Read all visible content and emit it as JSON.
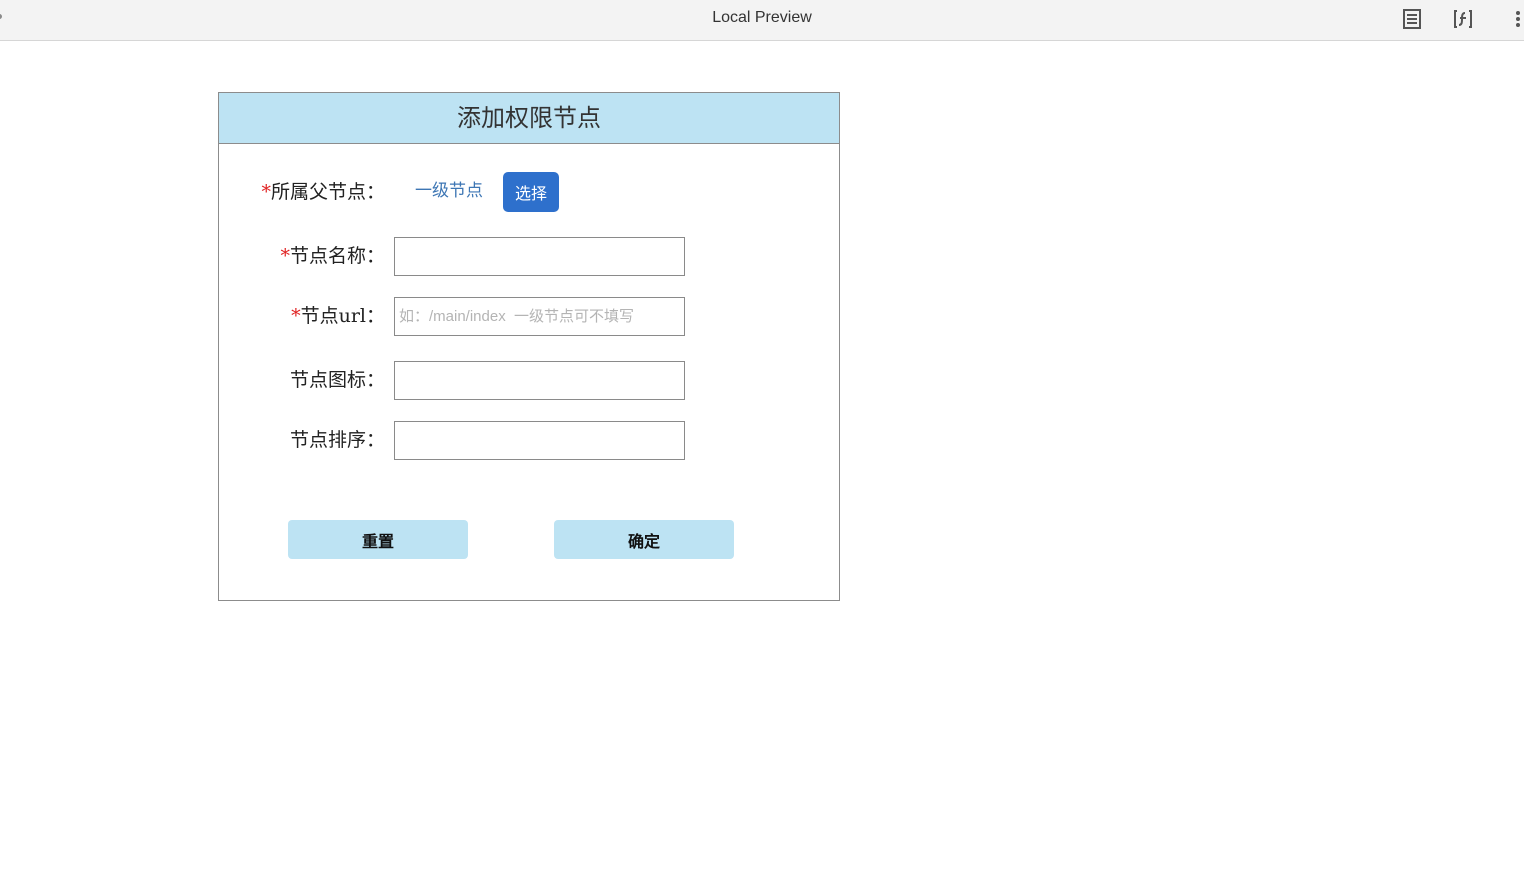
{
  "window": {
    "title": "Local Preview",
    "icons": [
      "reader-mode-icon",
      "function-icon",
      "more-vertical-icon"
    ]
  },
  "form": {
    "header": "添加权限节点",
    "required_mark": "*",
    "parent": {
      "label": "所属父节点：",
      "value": "一级节点",
      "select_button": "选择"
    },
    "name": {
      "label": "节点名称：",
      "value": "",
      "placeholder": ""
    },
    "url": {
      "label": "节点url：",
      "value": "",
      "placeholder": "如：/main/index  一级节点可不填写"
    },
    "icon": {
      "label": "节点图标：",
      "value": "",
      "placeholder": ""
    },
    "sort": {
      "label": "节点排序：",
      "value": "",
      "placeholder": ""
    },
    "reset_button": "重置",
    "submit_button": "确定"
  },
  "colors": {
    "header_bg": "#bde3f3",
    "select_button_bg": "#2e70cc",
    "required_mark": "#e02020",
    "parent_value": "#3d76b4"
  }
}
